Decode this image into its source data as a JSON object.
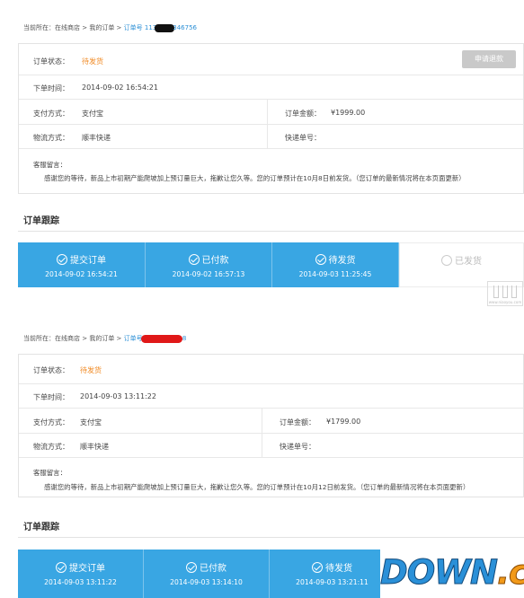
{
  "panel1": {
    "breadcrumb": {
      "prefix": "当前所在：",
      "home": "在线商店",
      "sep": " > ",
      "orders": "我的订单",
      "order_prefix": "订单号 113",
      "order_suffix": "346756"
    },
    "status_label": "订单状态：",
    "status_value": "待发货",
    "refund_button": "申请退款",
    "time_label": "下单时间：",
    "time_value": "2014-09-02 16:54:21",
    "pay_label": "支付方式：",
    "pay_value": "支付宝",
    "amount_label": "订单金额：",
    "amount_value": "¥1999.00",
    "ship_label": "物流方式：",
    "ship_value": "顺丰快递",
    "tracking_label": "快递单号：",
    "msg_label": "客服留言：",
    "msg_text": "感谢您的等待，新品上市初期产能爬坡加上预订量巨大，拖歉让您久等。您的订单预计在10月8日前发货。（您订单的最新情况将在本页面更新）",
    "track_heading": "订单跟踪",
    "steps": [
      {
        "title": "提交订单",
        "date": "2014-09-02 16:54:21"
      },
      {
        "title": "已付款",
        "date": "2014-09-02 16:57:13"
      },
      {
        "title": "待发货",
        "date": "2014-09-03 11:25:45"
      },
      {
        "title": "已发货",
        "date": ""
      }
    ]
  },
  "panel2": {
    "breadcrumb": {
      "prefix": "当前所在：",
      "home": "在线商店",
      "sep": " > ",
      "orders": "我的订单",
      "order_prefix": "订单号 ",
      "order_suffix": "8"
    },
    "status_label": "订单状态：",
    "status_value": "待发货",
    "time_label": "下单时间：",
    "time_value": "2014-09-03 13:11:22",
    "pay_label": "支付方式：",
    "pay_value": "支付宝",
    "amount_label": "订单金额：",
    "amount_value": "¥1799.00",
    "ship_label": "物流方式：",
    "ship_value": "顺丰快递",
    "tracking_label": "快递单号：",
    "msg_label": "客服留言：",
    "msg_text": "感谢您的等待，新品上市初期产能爬坡加上预订量巨大，拖歉让您久等。您的订单预计在10月12日前发货。（您订单的最新情况将在本页面更新）",
    "track_heading": "订单跟踪",
    "steps": [
      {
        "title": "提交订单",
        "date": "2014-09-03 13:11:22"
      },
      {
        "title": "已付款",
        "date": "2014-09-03 13:14:10"
      },
      {
        "title": "待发货",
        "date": "2014-09-03 13:21:11"
      }
    ]
  },
  "watermark": {
    "brand": "DOWN",
    "tld": ".cc",
    "small_caption": "www.niaoyou.com"
  },
  "colors": {
    "accent": "#39a6e3",
    "status_orange": "#f08a24",
    "link": "#2b8fd6"
  }
}
